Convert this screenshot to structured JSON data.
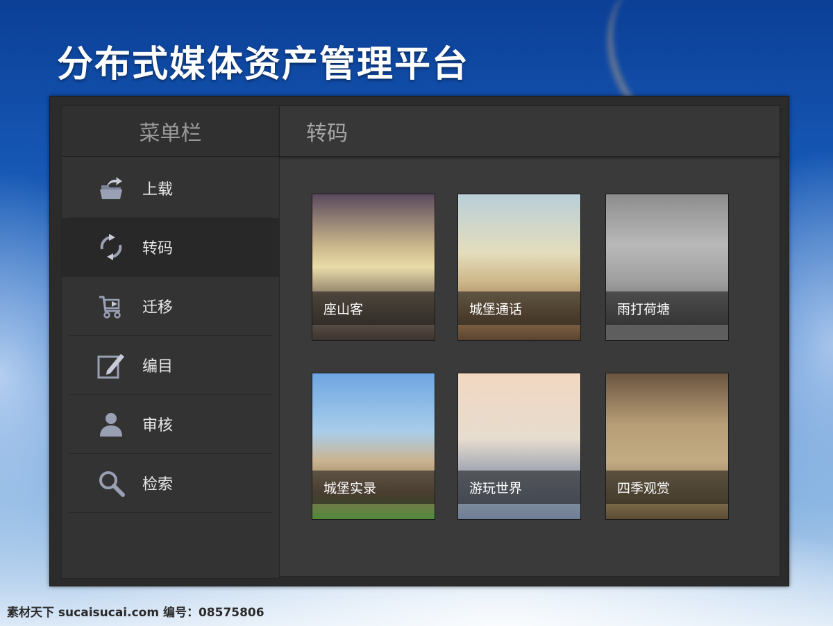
{
  "app": {
    "title": "分布式媒体资产管理平台"
  },
  "sidebar": {
    "header": "菜单栏",
    "items": [
      {
        "label": "上载",
        "icon": "upload-icon",
        "active": false
      },
      {
        "label": "转码",
        "icon": "refresh-icon",
        "active": true
      },
      {
        "label": "迁移",
        "icon": "cart-transfer-icon",
        "active": false
      },
      {
        "label": "编目",
        "icon": "edit-icon",
        "active": false
      },
      {
        "label": "审核",
        "icon": "user-icon",
        "active": false
      },
      {
        "label": "检索",
        "icon": "search-icon",
        "active": false
      }
    ]
  },
  "content": {
    "header": "转码",
    "tiles": [
      {
        "caption": "座山客"
      },
      {
        "caption": "城堡通话"
      },
      {
        "caption": "雨打荷塘"
      },
      {
        "caption": "城堡实录"
      },
      {
        "caption": "游玩世界"
      },
      {
        "caption": "四季观赏"
      }
    ]
  },
  "watermark": "素材天下 sucaisucai.com   编号：08575806",
  "colors": {
    "panel": "#3a3a3a",
    "sidebar": "#333333",
    "icon": "#c8ccd8"
  }
}
